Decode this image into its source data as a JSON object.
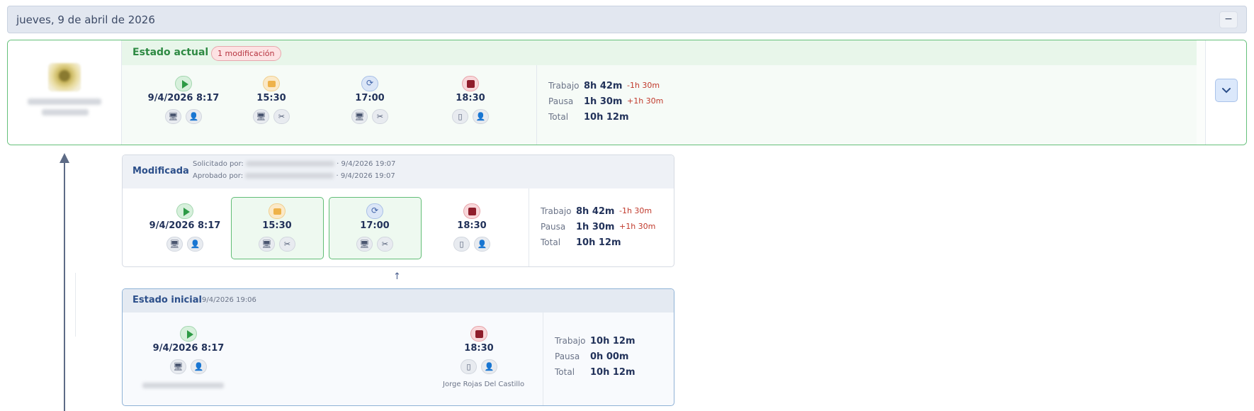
{
  "day": {
    "title": "jueves, 9 de abril de 2026",
    "collapse_label": "−"
  },
  "current": {
    "label": "Estado actual",
    "badge": "1 modificación",
    "events": [
      {
        "type": "start",
        "time": "9/4/2026 8:17",
        "icons": [
          "🖥",
          "👤"
        ]
      },
      {
        "type": "pause",
        "time": "15:30",
        "icons": [
          "🖥",
          "✂"
        ]
      },
      {
        "type": "resume",
        "time": "17:00",
        "icons": [
          "🖥",
          "✂"
        ]
      },
      {
        "type": "stop",
        "time": "18:30",
        "icons": [
          "▯",
          "👤"
        ]
      }
    ],
    "summary": {
      "trabajo_label": "Trabajo",
      "trabajo": "8h 42m",
      "trabajo_delta": "-1h 30m",
      "pausa_label": "Pausa",
      "pausa": "1h 30m",
      "pausa_delta": "+1h 30m",
      "total_label": "Total",
      "total": "10h 12m"
    },
    "expand_icon": "chevron-down-icon"
  },
  "modified": {
    "label": "Modificada",
    "requested_by_label": "Solicitado por:",
    "requested_at": "· 9/4/2026 19:07",
    "approved_by_label": "Aprobado por:",
    "approved_at": "· 9/4/2026 19:07",
    "events": [
      {
        "type": "start",
        "time": "9/4/2026 8:17",
        "icons": [
          "🖥",
          "👤"
        ]
      },
      {
        "type": "pause",
        "time": "15:30",
        "icons": [
          "🖥",
          "✂"
        ]
      },
      {
        "type": "resume",
        "time": "17:00",
        "icons": [
          "🖥",
          "✂"
        ]
      },
      {
        "type": "stop",
        "time": "18:30",
        "icons": [
          "▯",
          "👤"
        ]
      }
    ],
    "summary": {
      "trabajo_label": "Trabajo",
      "trabajo": "8h 42m",
      "trabajo_delta": "-1h 30m",
      "pausa_label": "Pausa",
      "pausa": "1h 30m",
      "pausa_delta": "+1h 30m",
      "total_label": "Total",
      "total": "10h 12m"
    }
  },
  "separator_arrow": "↑",
  "initial": {
    "label": "Estado inicial",
    "timestamp": "9/4/2026 19:06",
    "events": [
      {
        "type": "start",
        "time": "9/4/2026 8:17",
        "icons": [
          "🖥",
          "👤"
        ]
      },
      {
        "type": "stop",
        "time": "18:30",
        "icons": [
          "▯",
          "👤"
        ],
        "owner": "Jorge Rojas Del Castillo"
      }
    ],
    "summary": {
      "trabajo_label": "Trabajo",
      "trabajo": "10h 12m",
      "pausa_label": "Pausa",
      "pausa": "0h 00m",
      "total_label": "Total",
      "total": "10h 12m"
    }
  },
  "colors": {
    "current_border": "#65c07a",
    "modified_highlight": "#62bd76",
    "initial_border": "#8fb2d6",
    "delta": "#c0392b"
  }
}
